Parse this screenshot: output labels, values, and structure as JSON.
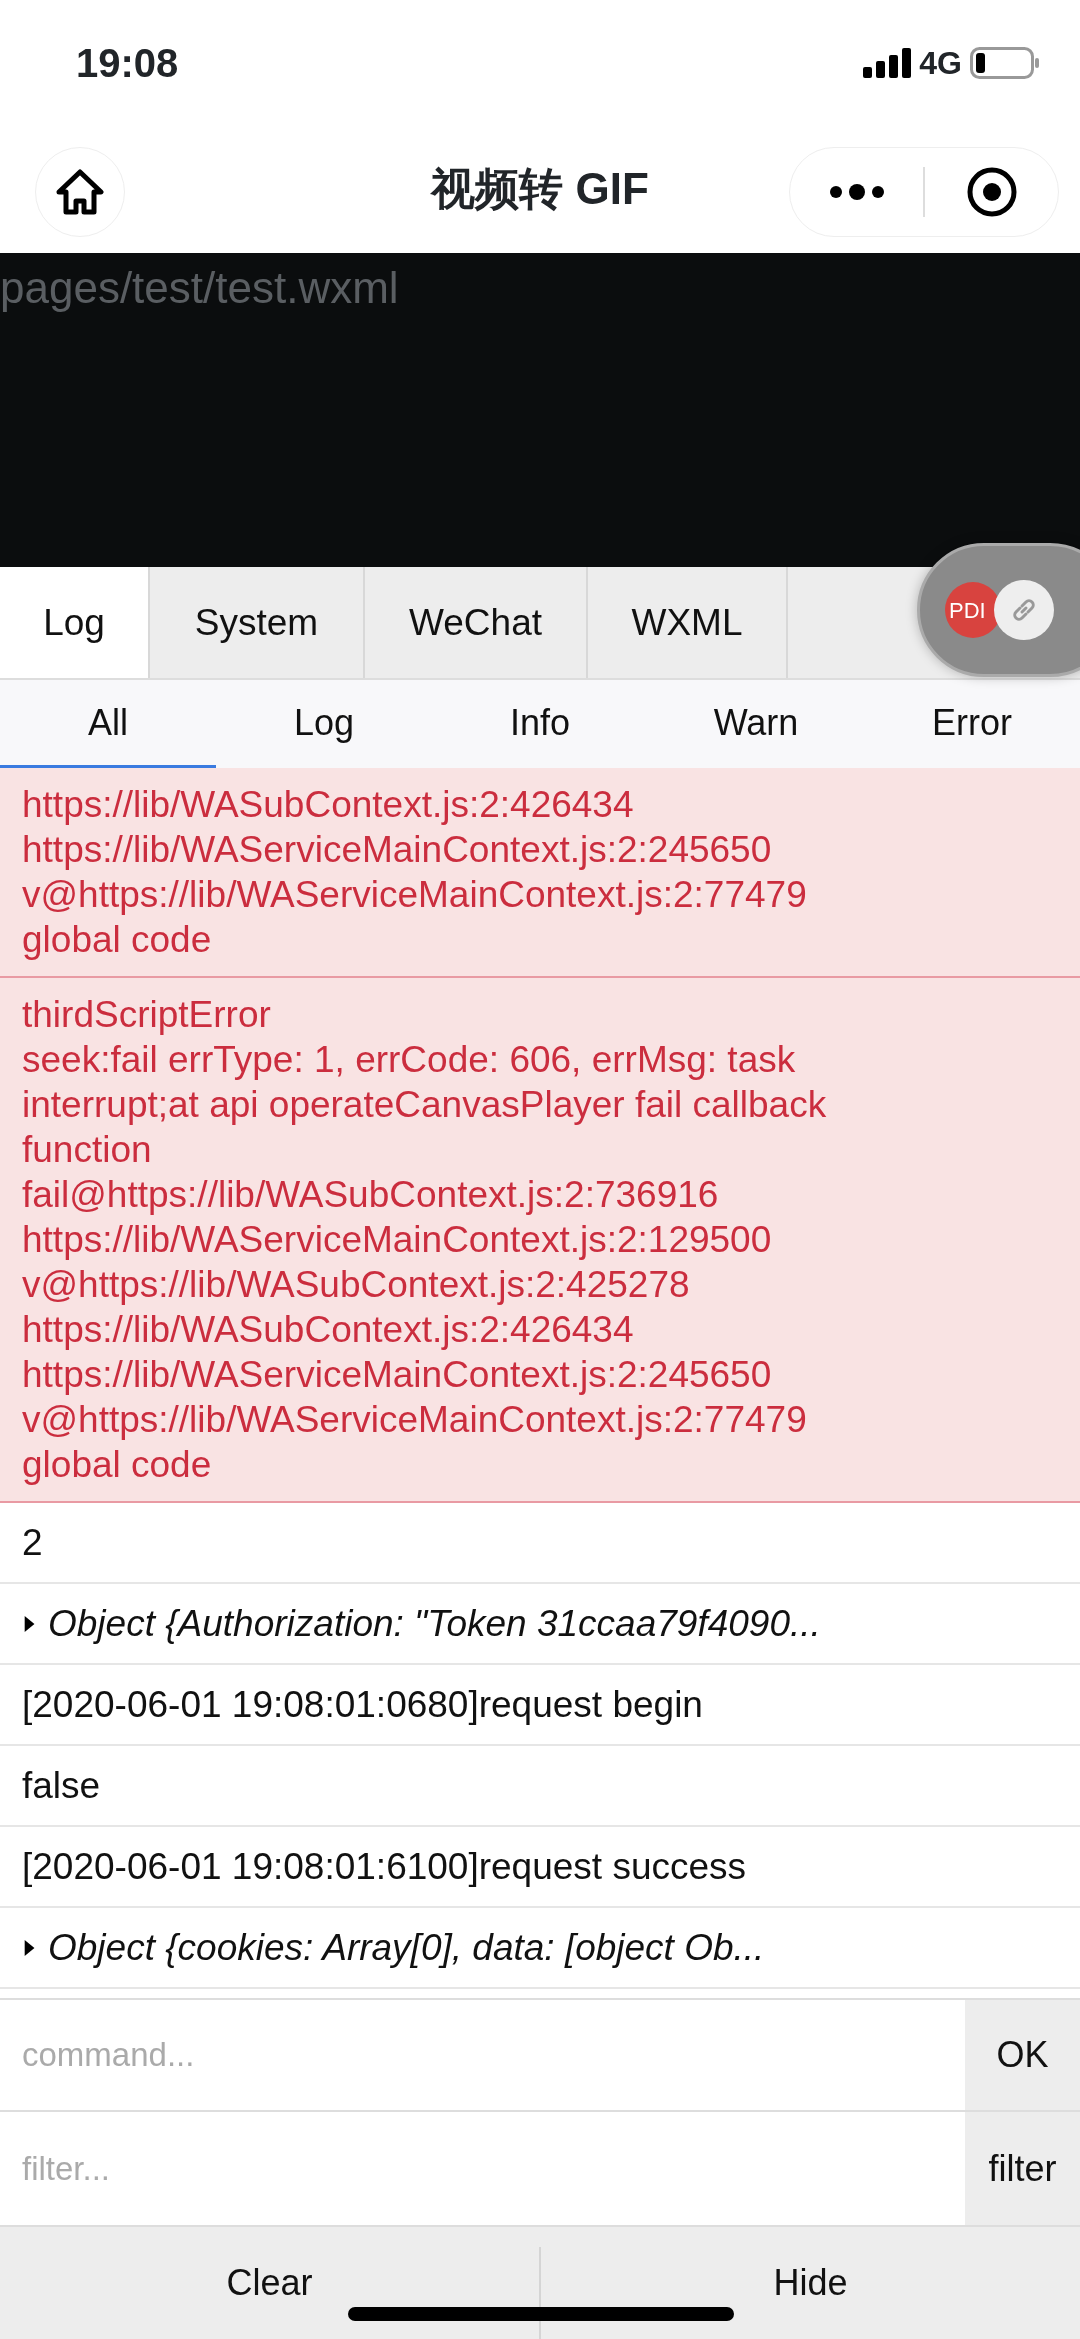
{
  "status_bar": {
    "time": "19:08",
    "network": "4G"
  },
  "nav": {
    "title": "视频转 GIF"
  },
  "page": {
    "path": "pages/test/test.wxml"
  },
  "tabs": [
    {
      "label": "Log",
      "selected": true
    },
    {
      "label": "System",
      "selected": false
    },
    {
      "label": "WeChat",
      "selected": false
    },
    {
      "label": "WXML",
      "selected": false
    }
  ],
  "floating_button": {
    "label": "PDI"
  },
  "filters": [
    {
      "label": "All",
      "selected": true
    },
    {
      "label": "Log",
      "selected": false
    },
    {
      "label": "Info",
      "selected": false
    },
    {
      "label": "Warn",
      "selected": false
    },
    {
      "label": "Error",
      "selected": false
    }
  ],
  "logs": [
    {
      "kind": "error",
      "lines": [
        "https://lib/WASubContext.js:2:426434",
        "https://lib/WAServiceMainContext.js:2:245650",
        "v@https://lib/WAServiceMainContext.js:2:77479",
        "global code"
      ]
    },
    {
      "kind": "error",
      "lines": [
        "thirdScriptError",
        "seek:fail errType: 1, errCode: 606, errMsg: task",
        "interrupt;at api operateCanvasPlayer fail callback",
        "function",
        "fail@https://lib/WASubContext.js:2:736916",
        "https://lib/WAServiceMainContext.js:2:129500",
        "v@https://lib/WASubContext.js:2:425278",
        "https://lib/WASubContext.js:2:426434",
        "https://lib/WAServiceMainContext.js:2:245650",
        "v@https://lib/WAServiceMainContext.js:2:77479",
        "global code"
      ]
    },
    {
      "kind": "log",
      "lines": [
        "2"
      ]
    },
    {
      "kind": "object",
      "expanded": false,
      "lines": [
        "Object {Authorization: \"Token 31ccaa79f4090..."
      ]
    },
    {
      "kind": "log",
      "lines": [
        "[2020-06-01 19:08:01:0680]request begin"
      ]
    },
    {
      "kind": "log",
      "lines": [
        "false"
      ]
    },
    {
      "kind": "log",
      "lines": [
        "[2020-06-01 19:08:01:6100]request success"
      ]
    },
    {
      "kind": "object",
      "expanded": false,
      "lines": [
        "Object {cookies: Array[0], data: [object Ob..."
      ]
    }
  ],
  "command": {
    "placeholder": "command...",
    "button": "OK"
  },
  "filter": {
    "placeholder": "filter...",
    "button": "filter"
  },
  "bottom_buttons": [
    "Clear",
    "Hide"
  ]
}
